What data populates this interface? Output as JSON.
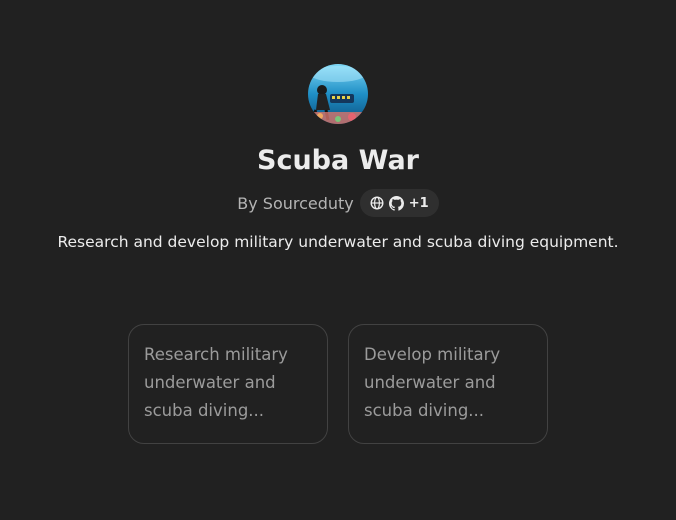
{
  "gpt": {
    "name": "Scuba War",
    "by_label": "By Sourceduty",
    "extra_count": "+1",
    "description": "Research and develop military underwater and scuba diving equipment.",
    "avatar_icon": "scuba-diver-avatar",
    "badge_icons": [
      "globe-icon",
      "github-icon"
    ]
  },
  "conversation_starters": [
    {
      "text": "Research military underwater and scuba diving..."
    },
    {
      "text": "Develop military underwater and scuba diving..."
    }
  ],
  "colors": {
    "background": "#212121",
    "text_primary": "#ececec",
    "text_secondary": "#b4b4b4",
    "starter_text": "#9b9b9b",
    "starter_border": "#424242",
    "pill_background": "#2f2f2f"
  }
}
